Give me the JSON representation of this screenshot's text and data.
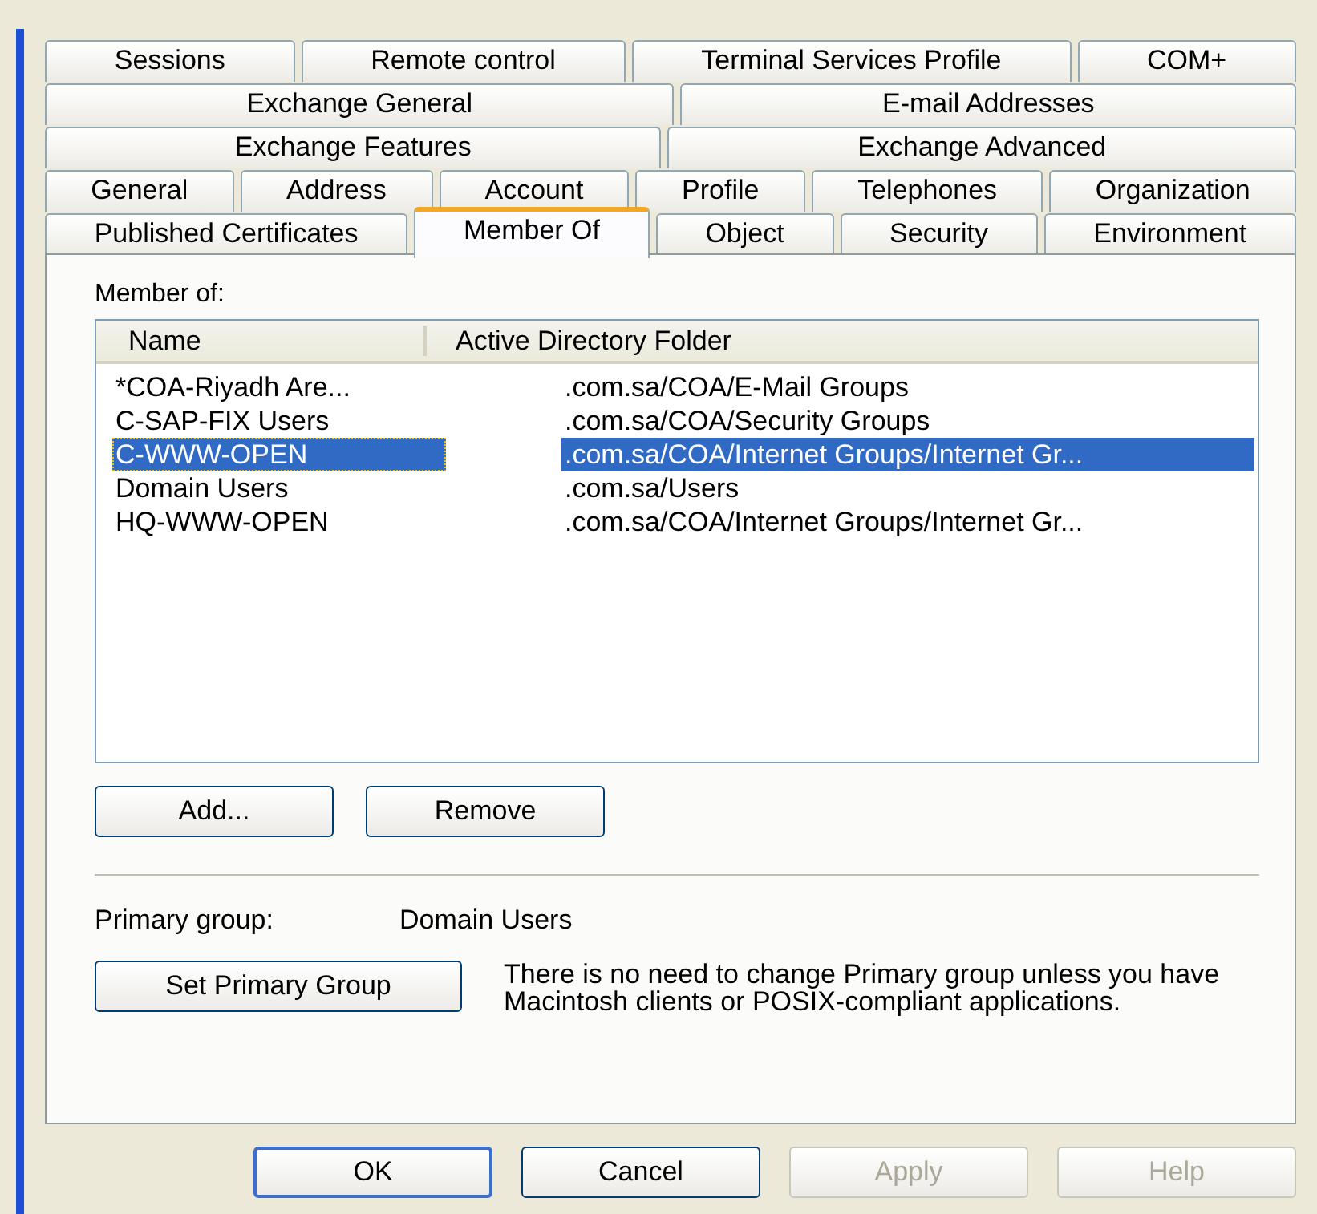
{
  "tab_rows": [
    [
      {
        "label": "Sessions",
        "selected": false
      },
      {
        "label": "Remote control",
        "selected": false
      },
      {
        "label": "Terminal Services Profile",
        "selected": false
      },
      {
        "label": "COM+",
        "selected": false
      }
    ],
    [
      {
        "label": "Exchange General",
        "selected": false
      },
      {
        "label": "E-mail Addresses",
        "selected": false
      }
    ],
    [
      {
        "label": "Exchange Features",
        "selected": false
      },
      {
        "label": "Exchange Advanced",
        "selected": false
      }
    ],
    [
      {
        "label": "General",
        "selected": false
      },
      {
        "label": "Address",
        "selected": false
      },
      {
        "label": "Account",
        "selected": false
      },
      {
        "label": "Profile",
        "selected": false
      },
      {
        "label": "Telephones",
        "selected": false
      },
      {
        "label": "Organization",
        "selected": false
      }
    ],
    [
      {
        "label": "Published Certificates",
        "selected": false
      },
      {
        "label": "Member Of",
        "selected": true
      },
      {
        "label": "Object",
        "selected": false
      },
      {
        "label": "Security",
        "selected": false
      },
      {
        "label": "Environment",
        "selected": false
      }
    ]
  ],
  "member_of": {
    "label": "Member of:",
    "columns": [
      "Name",
      "Active Directory Folder"
    ],
    "rows": [
      {
        "name": "*COA-Riyadh Are...",
        "folder": ".com.sa/COA/E-Mail Groups",
        "selected": false
      },
      {
        "name": "C-SAP-FIX Users",
        "folder": ".com.sa/COA/Security Groups",
        "selected": false
      },
      {
        "name": "C-WWW-OPEN",
        "folder": ".com.sa/COA/Internet Groups/Internet Gr...",
        "selected": true
      },
      {
        "name": "Domain Users",
        "folder": ".com.sa/Users",
        "selected": false
      },
      {
        "name": "HQ-WWW-OPEN",
        "folder": ".com.sa/COA/Internet Groups/Internet Gr...",
        "selected": false
      }
    ]
  },
  "list_buttons": [
    {
      "label": "Add..."
    },
    {
      "label": "Remove"
    }
  ],
  "primary_group": {
    "label": "Primary group:",
    "value": "Domain Users"
  },
  "set_primary": {
    "label": "Set Primary Group"
  },
  "note": "There is no need to change Primary group unless you have Macintosh clients or POSIX-compliant applications.",
  "dialog_buttons": [
    {
      "label": "OK",
      "disabled": false,
      "default": true
    },
    {
      "label": "Cancel",
      "disabled": false,
      "default": false
    },
    {
      "label": "Apply",
      "disabled": true,
      "default": false
    },
    {
      "label": "Help",
      "disabled": true,
      "default": false
    }
  ]
}
